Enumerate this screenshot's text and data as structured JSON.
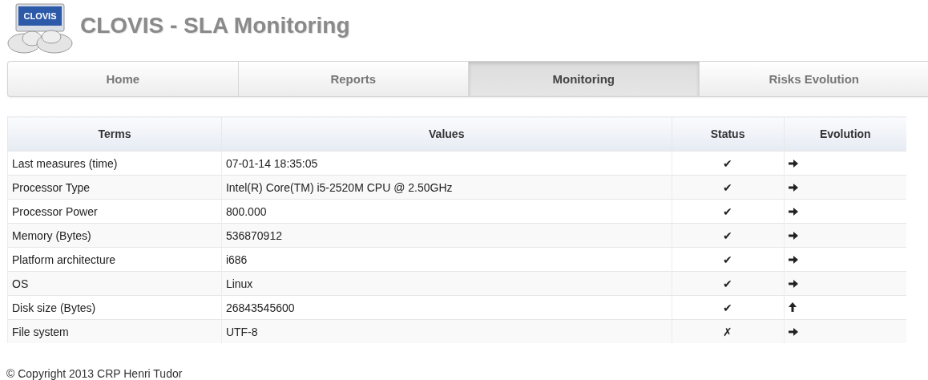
{
  "header": {
    "logo_text": "CLOVIS",
    "title": "CLOVIS - SLA Monitoring"
  },
  "tabs": [
    {
      "label": "Home",
      "selected": false
    },
    {
      "label": "Reports",
      "selected": false
    },
    {
      "label": "Monitoring",
      "selected": true
    },
    {
      "label": "Risks Evolution",
      "selected": false
    }
  ],
  "table": {
    "columns": [
      "Terms",
      "Values",
      "Status",
      "Evolution"
    ],
    "rows": [
      {
        "term": "Last measures (time)",
        "value": "07-01-14 18:35:05",
        "status": "✔",
        "evolution": {
          "kind": "right"
        }
      },
      {
        "term": "Processor Type",
        "value": "Intel(R) Core(TM) i5-2520M CPU @ 2.50GHz",
        "status": "✔",
        "evolution": {
          "kind": "right"
        }
      },
      {
        "term": "Processor Power",
        "value": "800.000",
        "status": "✔",
        "evolution": {
          "kind": "right"
        }
      },
      {
        "term": "Memory (Bytes)",
        "value": "536870912",
        "status": "✔",
        "evolution": {
          "kind": "right"
        }
      },
      {
        "term": "Platform architecture",
        "value": "i686",
        "status": "✔",
        "evolution": {
          "kind": "right"
        }
      },
      {
        "term": "OS",
        "value": "Linux",
        "status": "✔",
        "evolution": {
          "kind": "right"
        }
      },
      {
        "term": "Disk size (Bytes)",
        "value": "26843545600",
        "status": "✔",
        "evolution": {
          "kind": "up"
        }
      },
      {
        "term": "File system",
        "value": "UTF-8",
        "status": "✗",
        "evolution": {
          "kind": "right"
        }
      }
    ]
  },
  "footer": {
    "copyright": "© Copyright 2013 CRP Henri Tudor"
  }
}
